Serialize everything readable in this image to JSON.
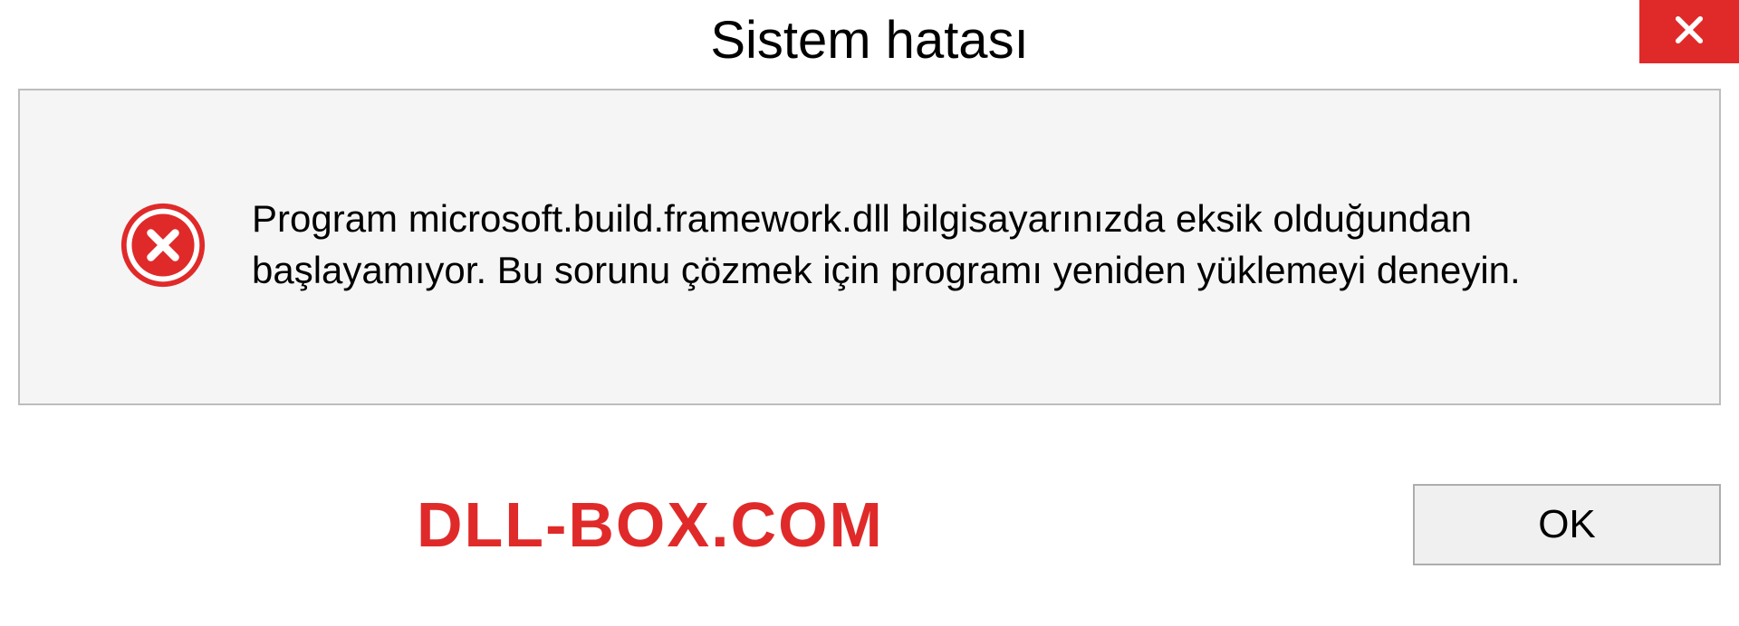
{
  "dialog": {
    "title": "Sistem hatası",
    "message": "Program microsoft.build.framework.dll bilgisayarınızda eksik olduğundan başlayamıyor. Bu sorunu çözmek için programı yeniden yüklemeyi deneyin.",
    "ok_label": "OK"
  },
  "watermark": "DLL-BOX.COM",
  "colors": {
    "close_bg": "#e02a2a",
    "watermark": "#e02a2a",
    "panel_bg": "#f5f5f5",
    "panel_border": "#bdbdbd"
  }
}
